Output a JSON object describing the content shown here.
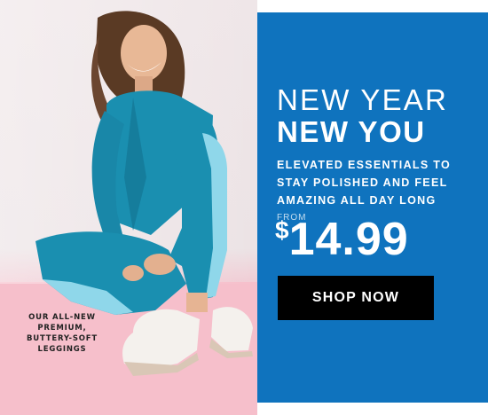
{
  "photo": {
    "caption": "OUR ALL-NEW PREMIUM, BUTTERY-SOFT LEGGINGS"
  },
  "promo": {
    "headline_line1": "NEW YEAR",
    "headline_line2": "NEW YOU",
    "subcopy": "ELEVATED ESSENTIALS TO STAY POLISHED AND FEEL AMAZING ALL DAY LONG",
    "price_prefix": "FROM",
    "price_currency": "$",
    "price_amount": "14.99",
    "cta_label": "SHOP NOW"
  },
  "colors": {
    "promo_background": "#0f73be",
    "cta_background": "#000000",
    "floor_pink": "#f6bfcb",
    "outfit_teal": "#1a8fb0",
    "outfit_stripe": "#8fd7ea"
  },
  "icons": [
    "model-photo"
  ]
}
